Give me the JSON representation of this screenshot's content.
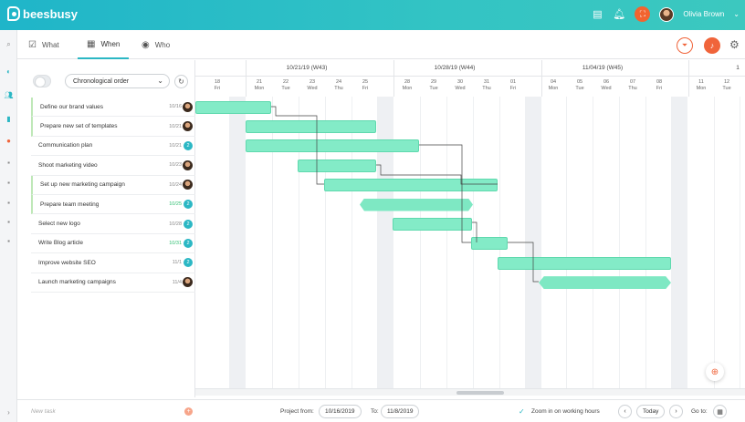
{
  "app": {
    "brand": "beesbusy",
    "user_name": "Olivia Brown"
  },
  "tabs": [
    {
      "label": "What",
      "icon": "checkbox-icon"
    },
    {
      "label": "When",
      "icon": "calendar-icon",
      "active": true
    },
    {
      "label": "Who",
      "icon": "user-icon"
    }
  ],
  "sort": {
    "label": "Chronological order"
  },
  "tasks": [
    {
      "name": "Define our brand values",
      "date": "10/16",
      "assignee": "avatar"
    },
    {
      "name": "Prepare new set of templates",
      "date": "10/21",
      "assignee": "avatar"
    },
    {
      "name": "Communication plan",
      "date": "10/21",
      "assignee": "2"
    },
    {
      "name": "Shoot marketing video",
      "date": "10/23",
      "assignee": "avatar"
    },
    {
      "name": "Set up new marketing campaign",
      "date": "10/24",
      "assignee": "avatar"
    },
    {
      "name": "Prepare team meeting",
      "date": "10/25",
      "assignee": "2",
      "date_color": "green"
    },
    {
      "name": "Select new logo",
      "date": "10/28",
      "assignee": "2"
    },
    {
      "name": "Write Blog article",
      "date": "10/31",
      "assignee": "2",
      "date_color": "green"
    },
    {
      "name": "Improve website SEO",
      "date": "11/1",
      "assignee": "2"
    },
    {
      "name": "Launch marketing campaigns",
      "date": "11/4",
      "assignee": "avatar"
    }
  ],
  "timeline": {
    "weeks": [
      "10/21/19 (W43)",
      "10/28/19 (W44)",
      "11/04/19 (W45)",
      "1"
    ],
    "days": [
      {
        "d": "18",
        "w": "Fri"
      },
      {
        "d": "21",
        "w": "Mon"
      },
      {
        "d": "22",
        "w": "Tue"
      },
      {
        "d": "23",
        "w": "Wed"
      },
      {
        "d": "24",
        "w": "Thu"
      },
      {
        "d": "25",
        "w": "Fri"
      },
      {
        "d": "28",
        "w": "Mon"
      },
      {
        "d": "29",
        "w": "Tue"
      },
      {
        "d": "30",
        "w": "Wed"
      },
      {
        "d": "31",
        "w": "Thu"
      },
      {
        "d": "01",
        "w": "Fri"
      },
      {
        "d": "04",
        "w": "Mon"
      },
      {
        "d": "05",
        "w": "Tue"
      },
      {
        "d": "06",
        "w": "Wed"
      },
      {
        "d": "07",
        "w": "Thu"
      },
      {
        "d": "08",
        "w": "Fri"
      },
      {
        "d": "11",
        "w": "Mon"
      },
      {
        "d": "12",
        "w": "Tue"
      }
    ]
  },
  "footer": {
    "new_task_placeholder": "New task",
    "project_from_label": "Project from:",
    "project_from": "10/16/2019",
    "to_label": "To:",
    "project_to": "11/8/2019",
    "zoom_label": "Zoom in on working hours",
    "today": "Today",
    "goto_label": "Go to:"
  },
  "colors": {
    "accent": "#2bb7c4",
    "bar": "#83ebc7",
    "alert": "#f0643a"
  }
}
